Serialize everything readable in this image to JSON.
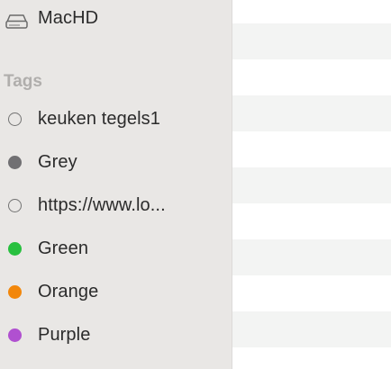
{
  "sidebar": {
    "locations": [
      {
        "label": "MacHD",
        "icon": "drive-icon"
      }
    ],
    "tags_header": "Tags",
    "tags": [
      {
        "label": "keuken tegels1",
        "color": null
      },
      {
        "label": "Grey",
        "color": "#717073"
      },
      {
        "label": "https://www.lo...",
        "color": null
      },
      {
        "label": "Green",
        "color": "#28c03f"
      },
      {
        "label": "Orange",
        "color": "#f2870b"
      },
      {
        "label": "Purple",
        "color": "#b050d0"
      }
    ]
  }
}
